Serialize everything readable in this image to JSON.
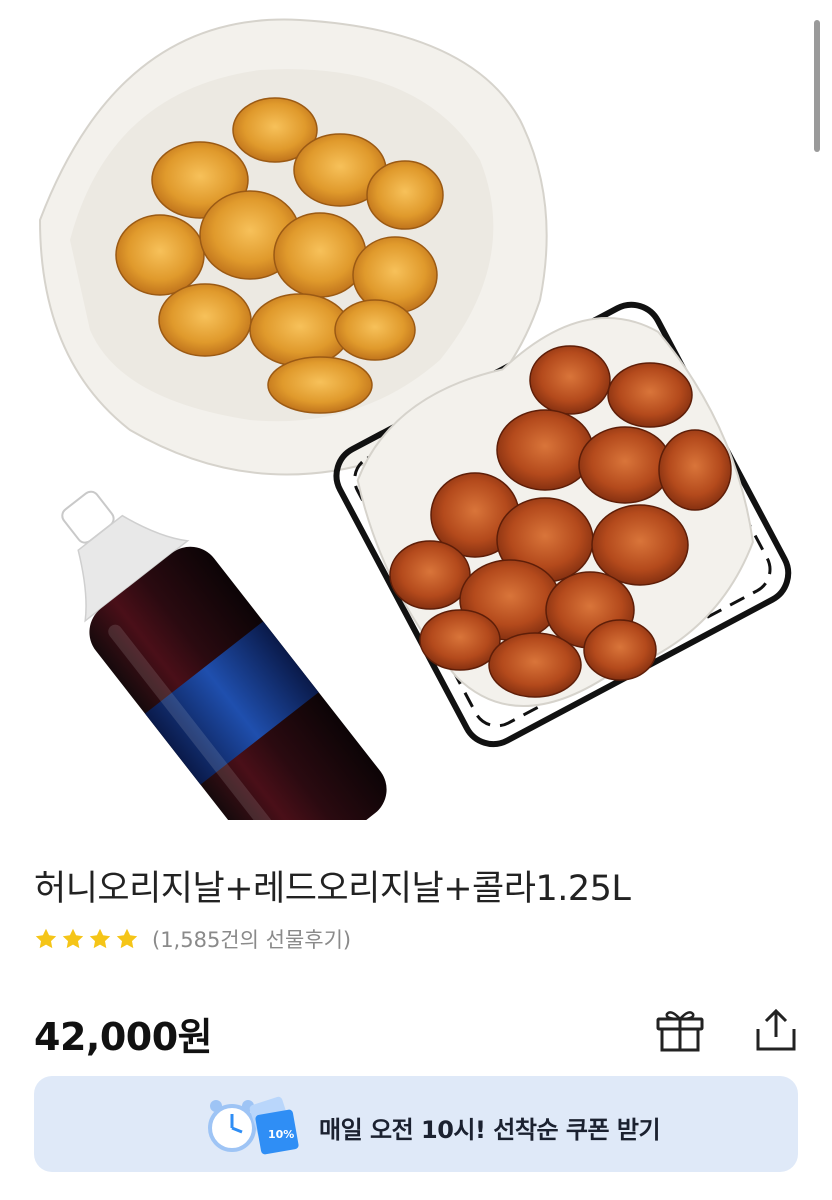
{
  "product": {
    "title": "허니오리지날+레드오리지날+콜라1.25L",
    "rating_stars": 4,
    "review_count_text": "(1,585건의 선물후기)",
    "price": "42,000원"
  },
  "actions": {
    "gift_icon": "gift-icon",
    "share_icon": "share-icon"
  },
  "coupon_banner": {
    "text": "매일 오전 10시! 선착순 쿠폰 받기",
    "badge_text": "10%",
    "background": "#dfe9f8"
  },
  "colors": {
    "star": "#f5c518",
    "coupon_accent": "#2f8ef5"
  }
}
